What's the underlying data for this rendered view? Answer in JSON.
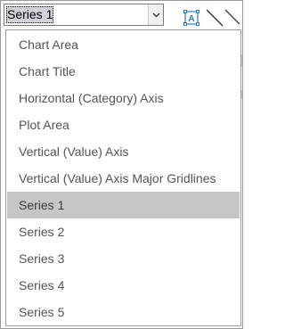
{
  "combo": {
    "value": "Series 1",
    "arrow_icon": "chevron-down-icon"
  },
  "toolbar": {
    "format_icon": "format-selection-icon",
    "line_icon": "line-tool-icon"
  },
  "dropdown": {
    "items": [
      {
        "label": "Chart Area",
        "selected": false
      },
      {
        "label": "Chart Title",
        "selected": false
      },
      {
        "label": "Horizontal (Category) Axis",
        "selected": false
      },
      {
        "label": "Plot Area",
        "selected": false
      },
      {
        "label": "Vertical (Value) Axis",
        "selected": false
      },
      {
        "label": "Vertical (Value) Axis Major Gridlines",
        "selected": false
      },
      {
        "label": "Series 1",
        "selected": true
      },
      {
        "label": "Series 2",
        "selected": false
      },
      {
        "label": "Series 3",
        "selected": false
      },
      {
        "label": "Series 4",
        "selected": false
      },
      {
        "label": "Series 5",
        "selected": false
      }
    ]
  },
  "colors": {
    "selected_bg": "#c6c6c6",
    "text": "#545454",
    "accent": "#2b79c2"
  }
}
